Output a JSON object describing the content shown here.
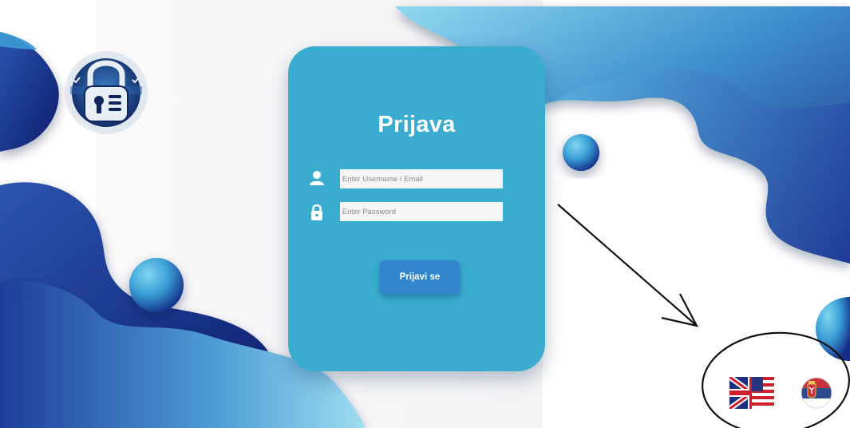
{
  "login": {
    "title": "Prijava",
    "username_placeholder": "Enter Username / Email",
    "password_placeholder": "Enter Password",
    "submit_label": "Prijavi se",
    "user_icon": "user-icon",
    "lock_icon": "lock-icon"
  },
  "logo": {
    "icon": "padlock-shield-logo"
  },
  "languages": [
    {
      "name": "english-flag",
      "icon": "uk-us-flag-icon"
    },
    {
      "name": "serbian-flag",
      "icon": "serbia-flag-icon"
    }
  ],
  "colors": {
    "card": "#3aaccf",
    "button": "#3185cc",
    "dark_blue": "#1b2f86",
    "light_blue": "#7fd0ea"
  }
}
